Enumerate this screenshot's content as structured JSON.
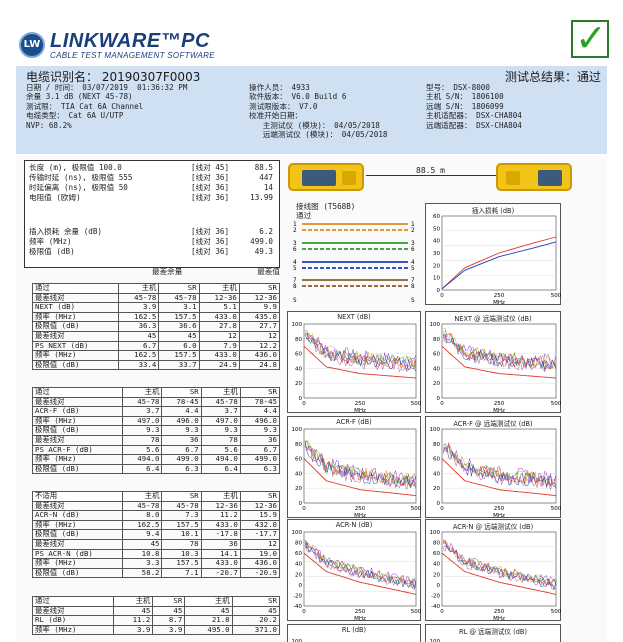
{
  "brand": {
    "name": "LINKWARE™PC",
    "sub": "CABLE TEST MANAGEMENT SOFTWARE",
    "logo": "LW"
  },
  "result": {
    "label": "测试总结果：通过",
    "mark": "✓",
    "pass_color": "#2aa12a"
  },
  "header": {
    "cable_id": "电缆识别名： 20190307F0003",
    "left": [
      "日期 / 时间： 03/07/2019  01:36:32 PM",
      "余量 3.1 dB (NEXT 45-78)",
      "测试限： TIA Cat 6A Channel",
      "电缆类型： Cat 6A U/UTP",
      "NVP: 68.2%"
    ],
    "mid": [
      "操作人员： 4933",
      "软件版本： V6.0 Build 6",
      "测试限版本： V7.0",
      "校准开始日期：",
      "   主测试仪 (模块)： 04/05/2018",
      "   远端测试仪 (模块)： 04/05/2018"
    ],
    "right": [
      "型号： DSX-8000",
      "主机 S/N： 1806100",
      "远端 S/N： 1806099",
      "主机适配器： DSX-CHA804",
      "远端适配器： DSX-CHA804"
    ]
  },
  "summary": [
    {
      "l": "长度 (m), 极限值 100.0",
      "m": "[线对 45]",
      "r": "88.5"
    },
    {
      "l": "传输时延 (ns), 极限值 555",
      "m": "[线对 36]",
      "r": "447"
    },
    {
      "l": "时延偏离 (ns), 极限值 50",
      "m": "[线对 36]",
      "r": "14"
    },
    {
      "l": "电阻值 (欧姆)",
      "m": "[线对 36]",
      "r": "13.99"
    },
    {
      "l": "插入损耗 余量 (dB)",
      "m": "[线对 36]",
      "r": "6.2"
    },
    {
      "l": "频率 (MHz)",
      "m": "[线对 36]",
      "r": "499.0"
    },
    {
      "l": "极限值 (dB)",
      "m": "[线对 36]",
      "r": "49.3"
    }
  ],
  "margin_header": {
    "worst_margin": "最差余量",
    "worst_value": "最差值"
  },
  "tables": [
    {
      "head": [
        "通过",
        "主机",
        "SR",
        "主机",
        "SR"
      ],
      "rows": [
        [
          "最差线对",
          "45-78",
          "45-78",
          "12-36",
          "12-36"
        ],
        [
          "NEXT (dB)",
          "3.9",
          "3.1",
          "5.1",
          "9.9"
        ],
        [
          "频率 (MHz)",
          "162.5",
          "157.5",
          "433.0",
          "435.0"
        ],
        [
          "极限值 (dB)",
          "36.3",
          "36.6",
          "27.8",
          "27.7"
        ],
        [
          "最差线对",
          "45",
          "45",
          "12",
          "12"
        ],
        [
          "PS NEXT (dB)",
          "6.7",
          "6.0",
          "7.9",
          "12.2"
        ],
        [
          "频率 (MHz)",
          "162.5",
          "157.5",
          "433.0",
          "436.0"
        ],
        [
          "极限值 (dB)",
          "33.4",
          "33.7",
          "24.9",
          "24.8"
        ]
      ]
    },
    {
      "head": [
        "通过",
        "主机",
        "SR",
        "主机",
        "SR"
      ],
      "rows": [
        [
          "最差线对",
          "45-78",
          "78-45",
          "45-78",
          "78-45"
        ],
        [
          "ACR-F (dB)",
          "3.7",
          "4.4",
          "3.7",
          "4.4"
        ],
        [
          "频率 (MHz)",
          "497.0",
          "496.0",
          "497.0",
          "496.0"
        ],
        [
          "极限值 (dB)",
          "9.3",
          "9.3",
          "9.3",
          "9.3"
        ],
        [
          "最差线对",
          "78",
          "36",
          "78",
          "36"
        ],
        [
          "PS ACR-F (dB)",
          "5.6",
          "6.7",
          "5.6",
          "6.7"
        ],
        [
          "频率 (MHz)",
          "494.0",
          "499.0",
          "494.0",
          "499.0"
        ],
        [
          "极限值 (dB)",
          "6.4",
          "6.3",
          "6.4",
          "6.3"
        ]
      ]
    },
    {
      "head": [
        "不适用",
        "主机",
        "SR",
        "主机",
        "SR"
      ],
      "rows": [
        [
          "最差线对",
          "45-78",
          "45-78",
          "12-36",
          "12-36"
        ],
        [
          "ACR-N (dB)",
          "8.0",
          "7.3",
          "11.2",
          "15.9"
        ],
        [
          "频率 (MHz)",
          "162.5",
          "157.5",
          "433.0",
          "432.0"
        ],
        [
          "极限值 (dB)",
          "9.4",
          "10.1",
          "-17.8",
          "-17.7"
        ],
        [
          "最差线对",
          "45",
          "78",
          "36",
          "12"
        ],
        [
          "PS ACR-N (dB)",
          "10.8",
          "10.3",
          "14.1",
          "19.0"
        ],
        [
          "频率 (MHz)",
          "3.3",
          "157.5",
          "433.0",
          "436.0"
        ],
        [
          "极限值 (dB)",
          "58.2",
          "7.1",
          "-20.7",
          "-20.9"
        ]
      ]
    },
    {
      "head": [
        "通过",
        "主机",
        "SR",
        "主机",
        "SR"
      ],
      "rows": [
        [
          "最差线对",
          "45",
          "45",
          "45",
          "45"
        ],
        [
          "RL (dB)",
          "11.2",
          "8.7",
          "21.8",
          "20.2"
        ],
        [
          "频率 (MHz)",
          "3.9",
          "3.9",
          "495.0",
          "371.0"
        ]
      ]
    }
  ],
  "length_label": "88.5 m",
  "wiremap": {
    "title": "接线图 (T568B)",
    "status": "通过",
    "pins": [
      "1",
      "2",
      "3",
      "6",
      "4",
      "5",
      "7",
      "8"
    ],
    "shield": "S"
  },
  "chart_data": [
    {
      "type": "line",
      "title": "插入损耗 (dB)",
      "xlabel": "MHz",
      "xlim": [
        0,
        500
      ],
      "ylim": [
        0,
        60
      ],
      "yticks": [
        "60",
        "50",
        "40",
        "30",
        "20",
        "10",
        "0"
      ],
      "xticks": [
        "0",
        "250",
        "500"
      ],
      "series": [
        {
          "values_x": [
            0,
            100,
            250,
            400,
            500
          ],
          "values_y": [
            1,
            18,
            30,
            38,
            43
          ]
        },
        {
          "values_x": [
            0,
            100,
            250,
            400,
            500
          ],
          "values_y": [
            1,
            16,
            27,
            34,
            39
          ]
        }
      ]
    },
    {
      "type": "line",
      "title": "NEXT (dB)",
      "xlabel": "MHz",
      "xlim": [
        0,
        500
      ],
      "ylim": [
        0,
        100
      ],
      "yticks": [
        "100",
        "80",
        "60",
        "40",
        "20",
        "0"
      ],
      "xticks": [
        "0",
        "250",
        "500"
      ],
      "noise": true,
      "limit": [
        [
          0,
          70
        ],
        [
          100,
          42
        ],
        [
          250,
          33
        ],
        [
          500,
          27
        ]
      ]
    },
    {
      "type": "line",
      "title": "NEXT @ 远端测试仪 (dB)",
      "xlabel": "MHz",
      "xlim": [
        0,
        500
      ],
      "ylim": [
        0,
        100
      ],
      "yticks": [
        "100",
        "80",
        "60",
        "40",
        "20",
        "0"
      ],
      "xticks": [
        "0",
        "250",
        "500"
      ],
      "noise": true,
      "limit": [
        [
          0,
          70
        ],
        [
          100,
          42
        ],
        [
          250,
          33
        ],
        [
          500,
          27
        ]
      ]
    },
    {
      "type": "line",
      "title": "ACR-F (dB)",
      "xlabel": "MHz",
      "xlim": [
        0,
        500
      ],
      "ylim": [
        0,
        100
      ],
      "yticks": [
        "100",
        "80",
        "60",
        "40",
        "20",
        "0"
      ],
      "xticks": [
        "0",
        "250",
        "500"
      ],
      "noise": true,
      "limit": [
        [
          0,
          60
        ],
        [
          100,
          30
        ],
        [
          250,
          18
        ],
        [
          500,
          10
        ]
      ]
    },
    {
      "type": "line",
      "title": "ACR-F @ 远端测试仪 (dB)",
      "xlabel": "MHz",
      "xlim": [
        0,
        500
      ],
      "ylim": [
        0,
        100
      ],
      "yticks": [
        "100",
        "80",
        "60",
        "40",
        "20",
        "0"
      ],
      "xticks": [
        "0",
        "250",
        "500"
      ],
      "noise": true,
      "limit": [
        [
          0,
          60
        ],
        [
          100,
          30
        ],
        [
          250,
          18
        ],
        [
          500,
          10
        ]
      ]
    },
    {
      "type": "line",
      "title": "ACR-N (dB)",
      "xlabel": "MHz",
      "xlim": [
        0,
        500
      ],
      "ylim": [
        -40,
        100
      ],
      "yticks": [
        "100",
        "80",
        "60",
        "40",
        "20",
        "0",
        "-20",
        "-40"
      ],
      "xticks": [
        "0",
        "250",
        "500"
      ],
      "noise": true,
      "limit": [
        [
          0,
          60
        ],
        [
          100,
          25
        ],
        [
          250,
          5
        ],
        [
          500,
          -18
        ]
      ]
    },
    {
      "type": "line",
      "title": "ACR-N @ 远端测试仪 (dB)",
      "xlabel": "MHz",
      "xlim": [
        0,
        500
      ],
      "ylim": [
        -40,
        100
      ],
      "yticks": [
        "100",
        "80",
        "60",
        "40",
        "20",
        "0",
        "-20",
        "-40"
      ],
      "xticks": [
        "0",
        "250",
        "500"
      ],
      "noise": true,
      "limit": [
        [
          0,
          60
        ],
        [
          100,
          25
        ],
        [
          250,
          5
        ],
        [
          500,
          -18
        ]
      ]
    },
    {
      "type": "line",
      "title": "RL (dB)",
      "xlabel": "",
      "xlim": [
        0,
        500
      ],
      "ylim": [
        0,
        100
      ],
      "yticks": [
        "100"
      ],
      "xticks": [],
      "noise": false
    },
    {
      "type": "line",
      "title": "RL @ 远端测试仪 (dB)",
      "xlabel": "",
      "xlim": [
        0,
        500
      ],
      "ylim": [
        0,
        100
      ],
      "yticks": [
        "100"
      ],
      "xticks": [],
      "noise": false
    }
  ],
  "colors": {
    "header_bg": "#cfe0f2",
    "brand": "#1a3f7a",
    "limit": "#e0392b"
  }
}
